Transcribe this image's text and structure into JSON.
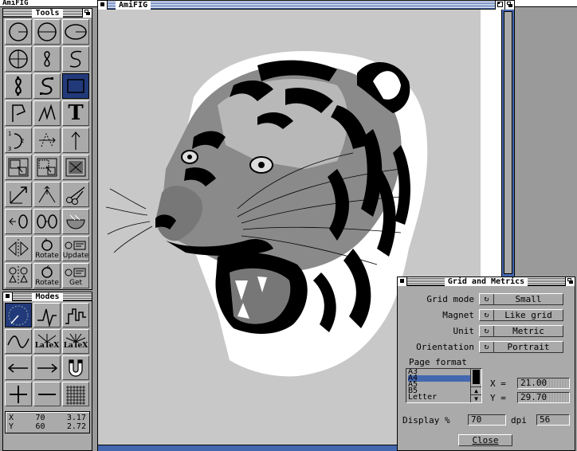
{
  "screen": {
    "title": "AmiFIG"
  },
  "tools": {
    "title": "Tools",
    "labels": {
      "rotate": "Rotate",
      "update": "Update",
      "get": "Get",
      "text_icon": "T",
      "num1": "1",
      "num2": "2",
      "num3": "3"
    }
  },
  "modes": {
    "title": "Modes",
    "latex1": "LaTeX",
    "latex2": "LaTeX",
    "coords": {
      "x_label": "X",
      "y_label": "Y",
      "x_px": "70",
      "x_cm": "3.17",
      "y_px": "60",
      "y_cm": "2.72"
    }
  },
  "canvas": {
    "title": "AmiFIG"
  },
  "grid_metrics": {
    "title": "Grid and Metrics",
    "grid_mode_label": "Grid mode",
    "grid_mode_value": "Small",
    "magnet_label": "Magnet",
    "magnet_value": "Like grid",
    "unit_label": "Unit",
    "unit_value": "Metric",
    "orientation_label": "Orientation",
    "orientation_value": "Portrait",
    "page_format_label": "Page format",
    "page_formats": [
      "A3",
      "A4",
      "A5",
      "B5",
      "Letter"
    ],
    "selected_format": "A4",
    "x_label": "X =",
    "x_value": "21.00",
    "y_label": "Y =",
    "y_value": "29.70",
    "display_label": "Display %",
    "display_value": "70",
    "dpi_label": "dpi",
    "dpi_value": "56",
    "close_label": "Close"
  },
  "colors": {
    "accent": "#4468b0",
    "selected_tool": "#223a7a",
    "window_bg": "#aaaaaa"
  }
}
